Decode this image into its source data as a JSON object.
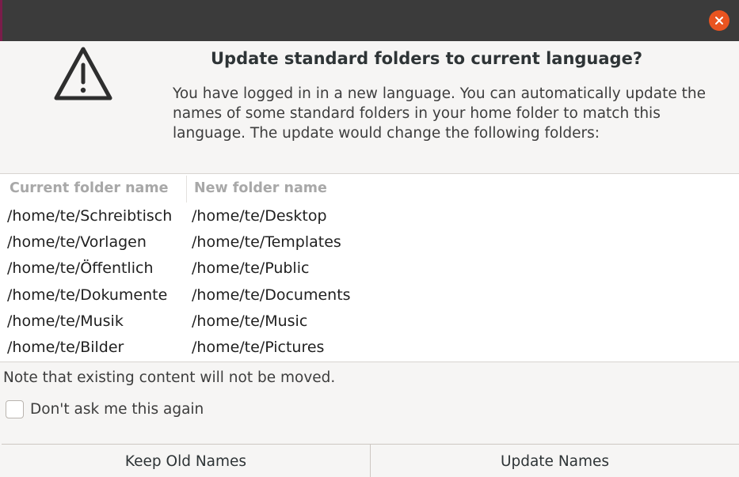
{
  "dialog": {
    "title": "Update standard folders to current language?",
    "description": "You have logged in in a new language. You can automatically update the names of some standard folders in your home folder to match this language. The update would change the following folders:",
    "icon": "warning-icon"
  },
  "table": {
    "headers": [
      "Current folder name",
      "New folder name"
    ],
    "rows": [
      [
        "/home/te/Schreibtisch",
        "/home/te/Desktop"
      ],
      [
        "/home/te/Vorlagen",
        "/home/te/Templates"
      ],
      [
        "/home/te/Öffentlich",
        "/home/te/Public"
      ],
      [
        "/home/te/Dokumente",
        "/home/te/Documents"
      ],
      [
        "/home/te/Musik",
        "/home/te/Music"
      ],
      [
        "/home/te/Bilder",
        "/home/te/Pictures"
      ]
    ]
  },
  "note": "Note that existing content will not be moved.",
  "checkbox": {
    "label": "Don't ask me this again",
    "checked": false
  },
  "buttons": {
    "keep": "Keep Old Names",
    "update": "Update Names"
  },
  "colors": {
    "close": "#e95420",
    "titlebar": "#3b3b3b"
  }
}
